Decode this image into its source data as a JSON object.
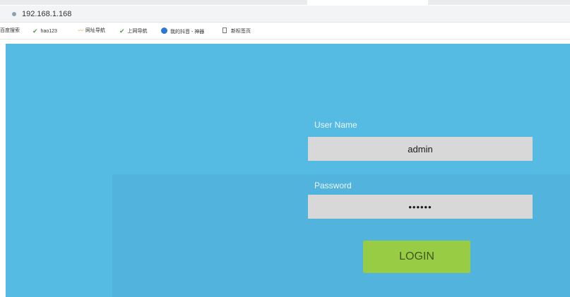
{
  "browser": {
    "url": "192.168.1.168",
    "bookmarks": [
      {
        "label": "百度搜索",
        "icon": "none"
      },
      {
        "label": "hao123",
        "icon": "green-check-icon"
      },
      {
        "label": "网址导航",
        "icon": "orange-wave-icon"
      },
      {
        "label": "上网导航",
        "icon": "green-check-icon"
      },
      {
        "label": "我的抖音 - 神器",
        "icon": "blue-globe-icon"
      },
      {
        "label": "新标签页",
        "icon": "page-icon"
      }
    ]
  },
  "login": {
    "username_label": "User Name",
    "username_value": "admin",
    "password_label": "Password",
    "password_value": "••••••",
    "button_label": "LOGIN"
  },
  "colors": {
    "page_background": "#56bbe3",
    "field_background": "#d8d8d8",
    "button_background": "#99cc45"
  }
}
